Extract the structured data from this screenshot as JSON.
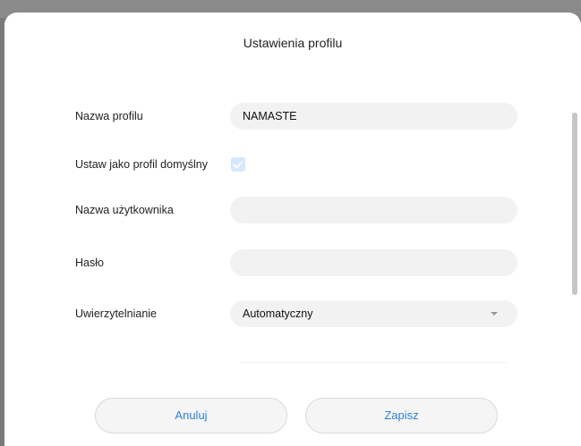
{
  "dialog": {
    "title": "Ustawienia profilu",
    "fields": {
      "profile_name": {
        "label": "Nazwa profilu",
        "value": "NAMASTE"
      },
      "default_profile": {
        "label": "Ustaw jako profil domyślny",
        "checked": true
      },
      "username": {
        "label": "Nazwa użytkownika",
        "value": ""
      },
      "password": {
        "label": "Hasło",
        "value": ""
      },
      "authentication": {
        "label": "Uwierzytelnianie",
        "value": "Automatyczny"
      }
    },
    "buttons": {
      "cancel": "Anuluj",
      "save": "Zapisz"
    }
  },
  "colors": {
    "accent": "#2f7fd6",
    "field_bg": "#f2f2f2",
    "checkbox": "#d5e8fb"
  },
  "icons": {
    "select_arrow": "chevron-down-icon",
    "checkbox": "check-icon"
  }
}
